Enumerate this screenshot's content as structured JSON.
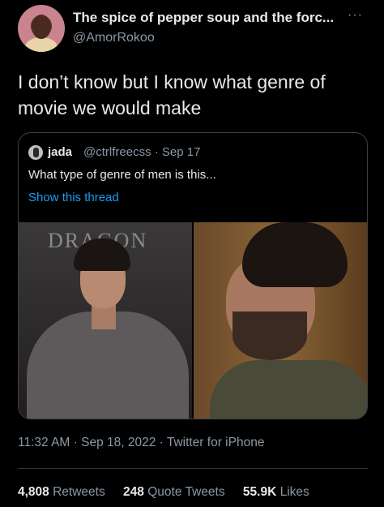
{
  "tweet": {
    "display_name": "The spice of pepper soup and the forc...",
    "handle": "@AmorRokoo",
    "more_label": "···",
    "text": "I don’t know but I know what genre of movie we would make"
  },
  "quoted_tweet": {
    "name": "jada",
    "meta": "@ctrlfreecss · Sep 17",
    "text": "What type of genre of men is this...",
    "link": "Show this thread",
    "image_sign_text": "DRAGON"
  },
  "footer": {
    "timestamp": "11:32 AM · Sep 18, 2022 · Twitter for iPhone",
    "stats": [
      {
        "value": "4,808",
        "label": "Retweets"
      },
      {
        "value": "248",
        "label": "Quote Tweets"
      },
      {
        "value": "55.9K",
        "label": "Likes"
      }
    ]
  }
}
